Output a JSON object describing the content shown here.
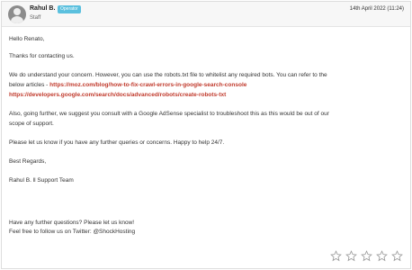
{
  "header": {
    "author": "Rahul B.",
    "badge": "Operator",
    "role": "Staff",
    "date": "14th April 2022 (11:24)"
  },
  "message": {
    "greeting": "Hello Renato,",
    "thanks": "Thanks for contacting us.",
    "para1_line1": "We do understand your concern. However, you can use the robots.txt file to whitelist any required bots. You can refer to the",
    "para1_line2_prefix": "below articles - ",
    "link1": "https://moz.com/blog/how-to-fix-crawl-errors-in-google-search-console",
    "link2": "https://developers.google.com/search/docs/advanced/robots/create-robots-txt",
    "para2_line1": "Also, going further, we suggest you consult with a Google AdSense specialist to troubleshoot this as this would be out of our",
    "para2_line2": "scope of support.",
    "para3": "Please let us know if you have any further queries or concerns. Happy to help 24/7.",
    "closing": "Best Regards,",
    "signature": "Rahul B. ll Support Team"
  },
  "footer": {
    "line1": "Have any further questions? Please let us know!",
    "line2": "Feel free to follow us on Twitter: @ShockHosting"
  },
  "rating": {
    "max": 5,
    "value": 0
  },
  "colors": {
    "badge": "#5bc0de",
    "link": "#c0392b",
    "header_bg": "#f7f7f7"
  }
}
